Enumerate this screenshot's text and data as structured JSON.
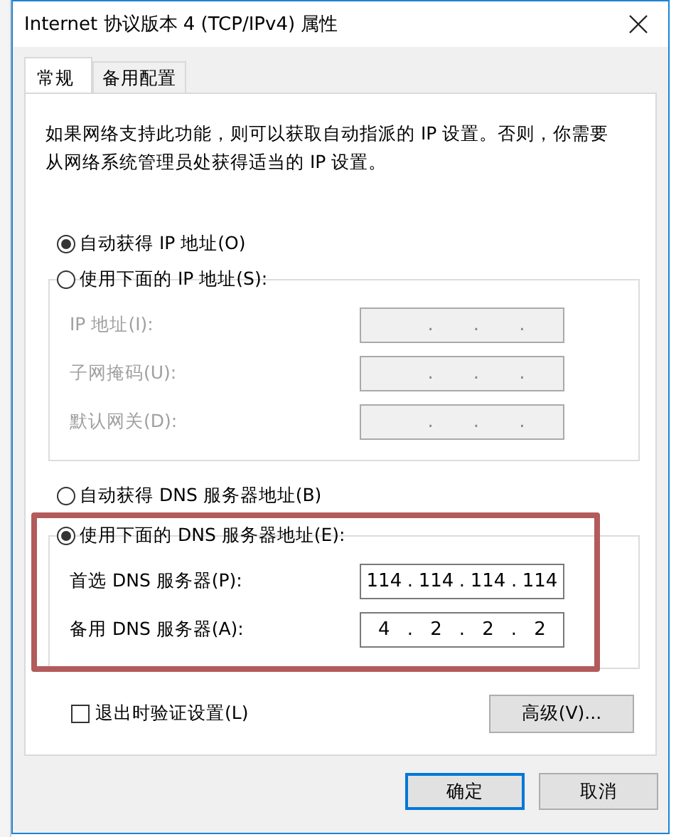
{
  "window": {
    "title": "Internet 协议版本 4 (TCP/IPv4) 属性"
  },
  "tabs": [
    {
      "label": "常规",
      "selected": true
    },
    {
      "label": "备用配置",
      "selected": false
    }
  ],
  "description": "如果网络支持此功能，则可以获取自动指派的 IP 设置。否则，你需要从网络系统管理员处获得适当的 IP 设置。",
  "ip_options": [
    {
      "label": "自动获得 IP 地址(O)",
      "selected": true
    },
    {
      "label": "使用下面的 IP 地址(S):",
      "selected": false
    }
  ],
  "ip_fields": [
    {
      "label": "IP 地址(I):",
      "disabled": true,
      "parts": [
        ".",
        ".",
        "."
      ]
    },
    {
      "label": "子网掩码(U):",
      "disabled": true,
      "parts": [
        ".",
        ".",
        "."
      ]
    },
    {
      "label": "默认网关(D):",
      "disabled": true,
      "parts": [
        ".",
        ".",
        "."
      ]
    }
  ],
  "dns_options": [
    {
      "label": "自动获得 DNS 服务器地址(B)",
      "selected": false
    },
    {
      "label": "使用下面的 DNS 服务器地址(E):",
      "selected": true
    }
  ],
  "dns_fields": [
    {
      "label": "首选 DNS 服务器(P):",
      "disabled": false,
      "parts": [
        "114",
        ".",
        "114",
        ".",
        "114",
        ".",
        "114"
      ]
    },
    {
      "label": "备用 DNS 服务器(A):",
      "disabled": false,
      "parts": [
        "4",
        ".",
        "2",
        ".",
        "2",
        ".",
        "2"
      ]
    }
  ],
  "validate_on_exit": {
    "label": "退出时验证设置(L)",
    "checked": false
  },
  "advanced_button": "高级(V)...",
  "dialog_buttons": [
    {
      "label": "确定",
      "default": true
    },
    {
      "label": "取消",
      "default": false
    }
  ]
}
